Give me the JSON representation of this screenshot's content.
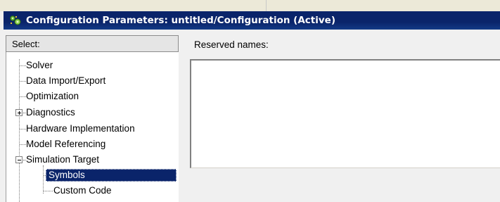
{
  "window": {
    "title": "Configuration Parameters: untitled/Configuration (Active)",
    "icon": "simulink-config-icon"
  },
  "left_panel": {
    "header": "Select:",
    "items": [
      {
        "label": "Solver",
        "expander": "none",
        "selected": false
      },
      {
        "label": "Data Import/Export",
        "expander": "none",
        "selected": false
      },
      {
        "label": "Optimization",
        "expander": "none",
        "selected": false
      },
      {
        "label": "Diagnostics",
        "expander": "collapsed",
        "selected": false
      },
      {
        "label": "Hardware Implementation",
        "expander": "none",
        "selected": false
      },
      {
        "label": "Model Referencing",
        "expander": "none",
        "selected": false
      },
      {
        "label": "Simulation Target",
        "expander": "expanded",
        "selected": false
      },
      {
        "label": "Symbols",
        "expander": "none",
        "selected": true
      },
      {
        "label": "Custom Code",
        "expander": "none",
        "selected": false
      }
    ]
  },
  "right_panel": {
    "reserved_names_label": "Reserved names:",
    "reserved_names_value": ""
  },
  "colors": {
    "titlebar": "#0a246a",
    "selection": "#0a246a",
    "window_bg": "#f0f0f0"
  }
}
